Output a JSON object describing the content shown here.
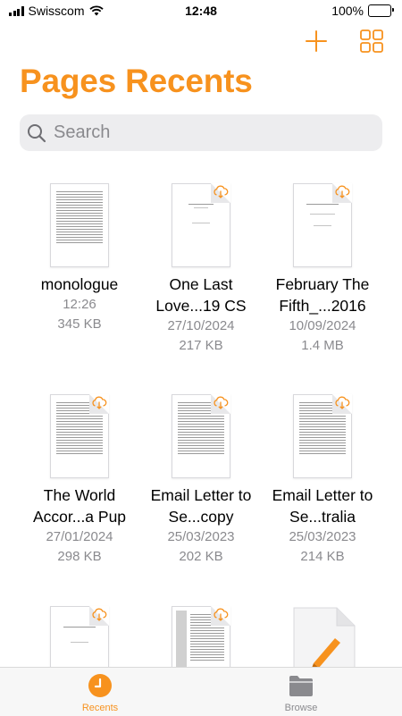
{
  "status_bar": {
    "carrier": "Swisscom",
    "time": "12:48",
    "battery": "100%"
  },
  "toolbar": {
    "add_icon": "plus-icon",
    "view_icon": "grid-view-icon"
  },
  "page": {
    "title": "Pages Recents"
  },
  "search": {
    "placeholder": "Search"
  },
  "documents": [
    {
      "name": "monologue",
      "date": "12:26",
      "size": "345 KB",
      "cloud": false
    },
    {
      "name": "One Last Love...19 CS",
      "date": "27/10/2024",
      "size": "217 KB",
      "cloud": true
    },
    {
      "name": "February The Fifth_...2016",
      "date": "10/09/2024",
      "size": "1.4 MB",
      "cloud": true
    },
    {
      "name": "The World Accor...a Pup",
      "date": "27/01/2024",
      "size": "298 KB",
      "cloud": true
    },
    {
      "name": "Email Letter to Se...copy",
      "date": "25/03/2023",
      "size": "202 KB",
      "cloud": true
    },
    {
      "name": "Email Letter to Se...tralia",
      "date": "25/03/2023",
      "size": "214 KB",
      "cloud": true
    }
  ],
  "tabs": {
    "recents": "Recents",
    "browse": "Browse"
  },
  "colors": {
    "accent": "#F7921E",
    "secondary_text": "#8A8A8E"
  }
}
